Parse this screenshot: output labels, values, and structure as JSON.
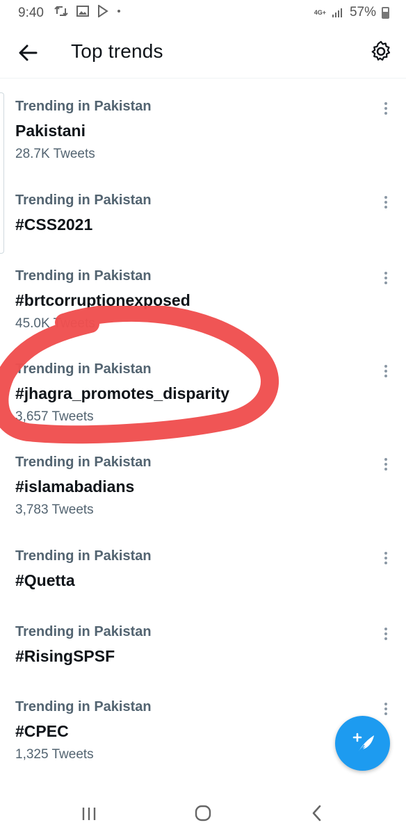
{
  "status_bar": {
    "time": "9:40",
    "network": "4G+",
    "battery": "57%"
  },
  "header": {
    "title": "Top trends"
  },
  "trends": [
    {
      "context": "Trending in Pakistan",
      "name": "Pakistani",
      "count": "28.7K Tweets"
    },
    {
      "context": "Trending in Pakistan",
      "name": "#CSS2021",
      "count": ""
    },
    {
      "context": "Trending in Pakistan",
      "name": "#brtcorruptionexposed",
      "count": "45.0K Tweets"
    },
    {
      "context": "Trending in Pakistan",
      "name": "#jhagra_promotes_disparity",
      "count": "3,657 Tweets"
    },
    {
      "context": "Trending in Pakistan",
      "name": "#islamabadians",
      "count": "3,783 Tweets"
    },
    {
      "context": "Trending in Pakistan",
      "name": "#Quetta",
      "count": ""
    },
    {
      "context": "Trending in Pakistan",
      "name": "#RisingSPSF",
      "count": ""
    },
    {
      "context": "Trending in Pakistan",
      "name": "#CPEC",
      "count": "1,325 Tweets"
    }
  ],
  "colors": {
    "accent": "#1d9bf0",
    "annotation": "#ef4f4f",
    "secondary_text": "#536471"
  }
}
